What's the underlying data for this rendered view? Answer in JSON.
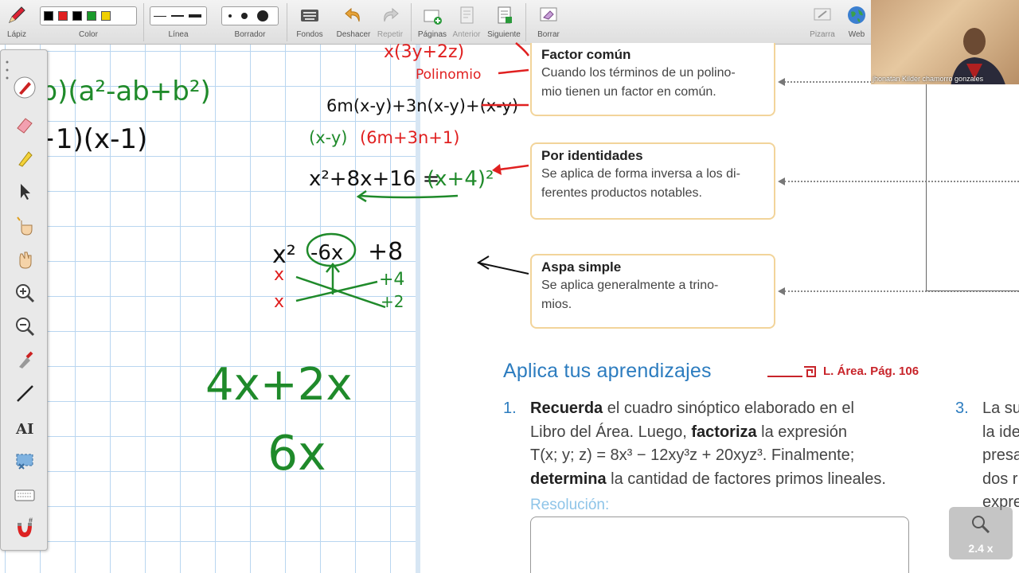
{
  "toolbar": {
    "items": {
      "lapiz": "Lápiz",
      "color": "Color",
      "linea": "Línea",
      "borrador": "Borrador",
      "fondos": "Fondos",
      "deshacer": "Deshacer",
      "repetir": "Repetir",
      "paginas": "Páginas",
      "anterior": "Anterior",
      "siguiente": "Siguiente",
      "borrar": "Borrar",
      "pizarra": "Pizarra",
      "web": "Web"
    },
    "colors": [
      "#000000",
      "#e02020",
      "#000000",
      "#1a9a2a",
      "#f0d000"
    ]
  },
  "handwriting": {
    "l1": "+b)(a²-ab+b²)",
    "l2": "(x+1)(x-1)",
    "l3a": "x(3y+2z)",
    "l3b": "Polinomio",
    "l4": "6m(x-y)+3n(x-y)+(x-y)",
    "l5a": "(x-y)",
    "l5b": "(6m+3n+1)",
    "l6a": "x²+8x+16 =",
    "l6b": "(x+4)²",
    "l7": "x²",
    "l7b": "-6x",
    "l7c": "+8",
    "l8a": "x",
    "l8b": "x",
    "l8c": "+4",
    "l8d": "+2",
    "l9": "4x+2x",
    "l10": "6x"
  },
  "boxes": [
    {
      "title": "Factor común",
      "body1": "Cuando los términos de un polino-",
      "body2": "mio tienen un factor en común."
    },
    {
      "title": "Por identidades",
      "body1": "Se aplica de forma inversa a los di-",
      "body2": "ferentes productos notables."
    },
    {
      "title": "Aspa simple",
      "body1": "Se aplica generalmente a trino-",
      "body2": "mios."
    }
  ],
  "apply": {
    "title": "Aplica tus aprendizajes",
    "ref": "L. Área. Pág. 106"
  },
  "q1": {
    "num": "1.",
    "w1": "Recuerda",
    "t1": " el cuadro sinóptico elaborado en el",
    "t2": "Libro del Área. Luego, ",
    "w2": "factoriza",
    "t3": " la expresión",
    "t4": "T(x; y; z) = 8x³ − 12xy³z + 20xyz³. Finalmente;",
    "w3": "determina",
    "t5": " la cantidad de factores primos lineales."
  },
  "resolution": "Resolución:",
  "q3": {
    "num": "3.",
    "l1": "La su",
    "l2": "la ide",
    "l3": "presa",
    "l4": "dos r",
    "l5": "expre"
  },
  "webcam": {
    "name": "jhonatan Kilder chamorro gonzales"
  },
  "zoom": {
    "label": "2.4 x"
  }
}
